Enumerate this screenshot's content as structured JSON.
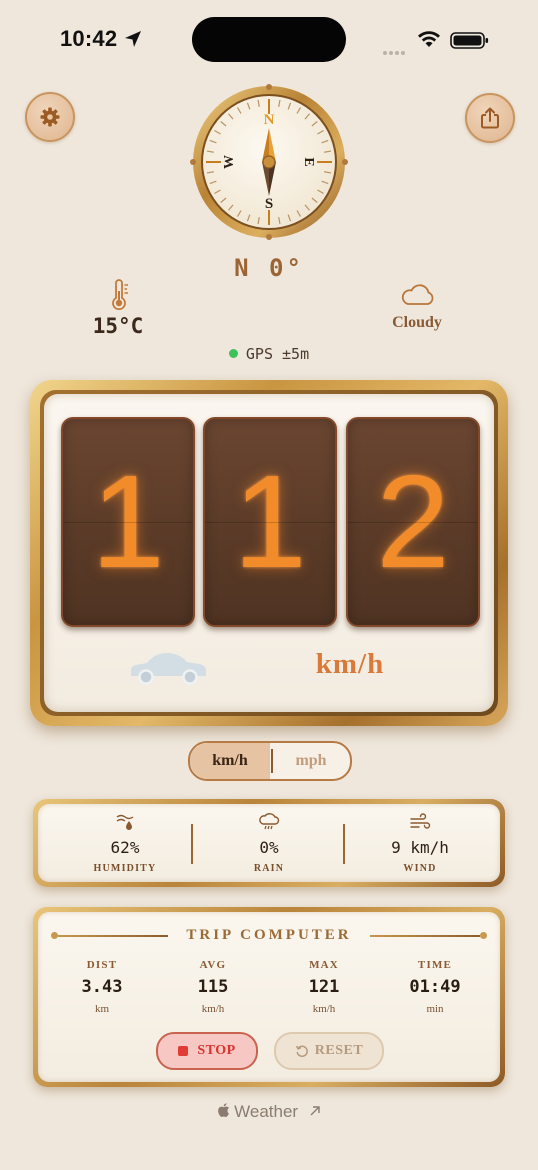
{
  "status_bar": {
    "time": "10:42",
    "icons": [
      "location-arrow-icon",
      "cellular-icon",
      "wifi-icon",
      "battery-icon"
    ]
  },
  "header": {
    "settings_icon": "gear-icon",
    "share_icon": "share-icon"
  },
  "compass": {
    "cardinal": {
      "n": "N",
      "e": "E",
      "s": "S",
      "w": "W"
    },
    "heading": "N 0°"
  },
  "conditions": {
    "temperature": "15°C",
    "temp_icon": "thermometer-icon",
    "sky": "Cloudy",
    "sky_icon": "cloud-icon",
    "gps": "GPS ±5m",
    "gps_status_color": "#3bc25a"
  },
  "speedometer": {
    "digits": [
      "1",
      "1",
      "2"
    ],
    "unit": "km/h",
    "vehicle_icon": "car-icon",
    "digit_color": "#f28c2a"
  },
  "unit_toggle": {
    "options": [
      "km/h",
      "mph"
    ],
    "selected": "km/h"
  },
  "weather": {
    "items": [
      {
        "icon": "humidity-icon",
        "value": "62%",
        "label": "HUMIDITY"
      },
      {
        "icon": "rain-icon",
        "value": "0%",
        "label": "RAIN"
      },
      {
        "icon": "wind-icon",
        "value": "9 km/h",
        "label": "WIND"
      }
    ]
  },
  "trip": {
    "title": "TRIP COMPUTER",
    "stats": [
      {
        "label": "DIST",
        "value": "3.43",
        "unit": "km"
      },
      {
        "label": "AVG",
        "value": "115",
        "unit": "km/h"
      },
      {
        "label": "MAX",
        "value": "121",
        "unit": "km/h"
      },
      {
        "label": "TIME",
        "value": "01:49",
        "unit": "min"
      }
    ],
    "stop_label": "STOP",
    "reset_label": "RESET"
  },
  "footer": {
    "text": "Weather",
    "icons": [
      "apple-icon",
      "external-link-icon"
    ]
  },
  "colors": {
    "background": "#efe7dc",
    "brass": "#c99541",
    "accent_orange": "#d9793a",
    "stop_red": "#e23a34"
  }
}
